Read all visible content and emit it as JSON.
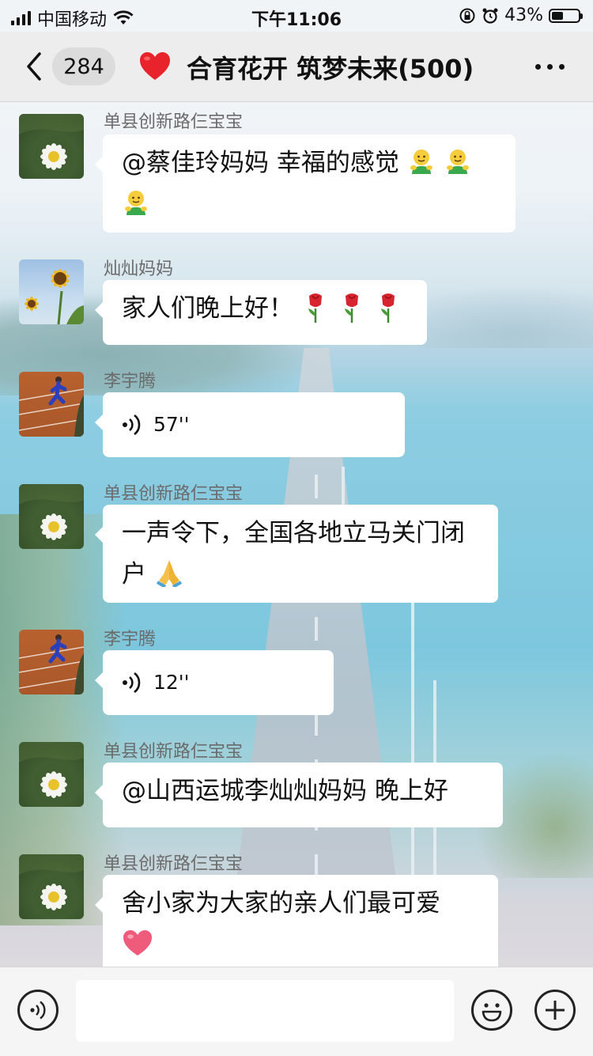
{
  "status_bar": {
    "carrier": "中国移动",
    "time": "下午11:06",
    "battery": "43%",
    "battery_level": 0.43
  },
  "nav": {
    "back_icon": "chevron-left-icon",
    "unread_count": "284",
    "title_icon": "red-heart-icon",
    "title": "合育花开 筑梦未来(500)",
    "more_icon": "more-dots-icon"
  },
  "messages": [
    {
      "sender": "单县创新路仨宝宝",
      "avatar": "daisy-avatar",
      "type": "text",
      "text": "@蔡佳玲妈妈 幸福的感觉",
      "emojis": [
        "smiley-hug-emoji",
        "smiley-hug-emoji",
        "smiley-hug-emoji"
      ]
    },
    {
      "sender": "灿灿妈妈",
      "avatar": "sunflower-avatar",
      "type": "text",
      "text": "家人们晚上好！",
      "emojis": [
        "rose-emoji",
        "rose-emoji",
        "rose-emoji"
      ]
    },
    {
      "sender": "李宇腾",
      "avatar": "running-track-avatar",
      "type": "voice",
      "duration": "57''"
    },
    {
      "sender": "单县创新路仨宝宝",
      "avatar": "daisy-avatar",
      "type": "text",
      "text": "一声令下，全国各地立马关门闭户",
      "emojis": [
        "pray-emoji"
      ]
    },
    {
      "sender": "李宇腾",
      "avatar": "running-track-avatar",
      "type": "voice",
      "duration": "12''"
    },
    {
      "sender": "单县创新路仨宝宝",
      "avatar": "daisy-avatar",
      "type": "text",
      "text": "@山西运城李灿灿妈妈 晚上好",
      "emojis": []
    },
    {
      "sender": "单县创新路仨宝宝",
      "avatar": "daisy-avatar",
      "type": "text",
      "text": "舍小家为大家的亲人们最可爱",
      "emojis": [
        "pink-heart-emoji"
      ]
    }
  ],
  "input_bar": {
    "voice_icon": "voice-input-icon",
    "emoji_icon": "emoji-icon",
    "plus_icon": "plus-icon",
    "input_value": ""
  }
}
